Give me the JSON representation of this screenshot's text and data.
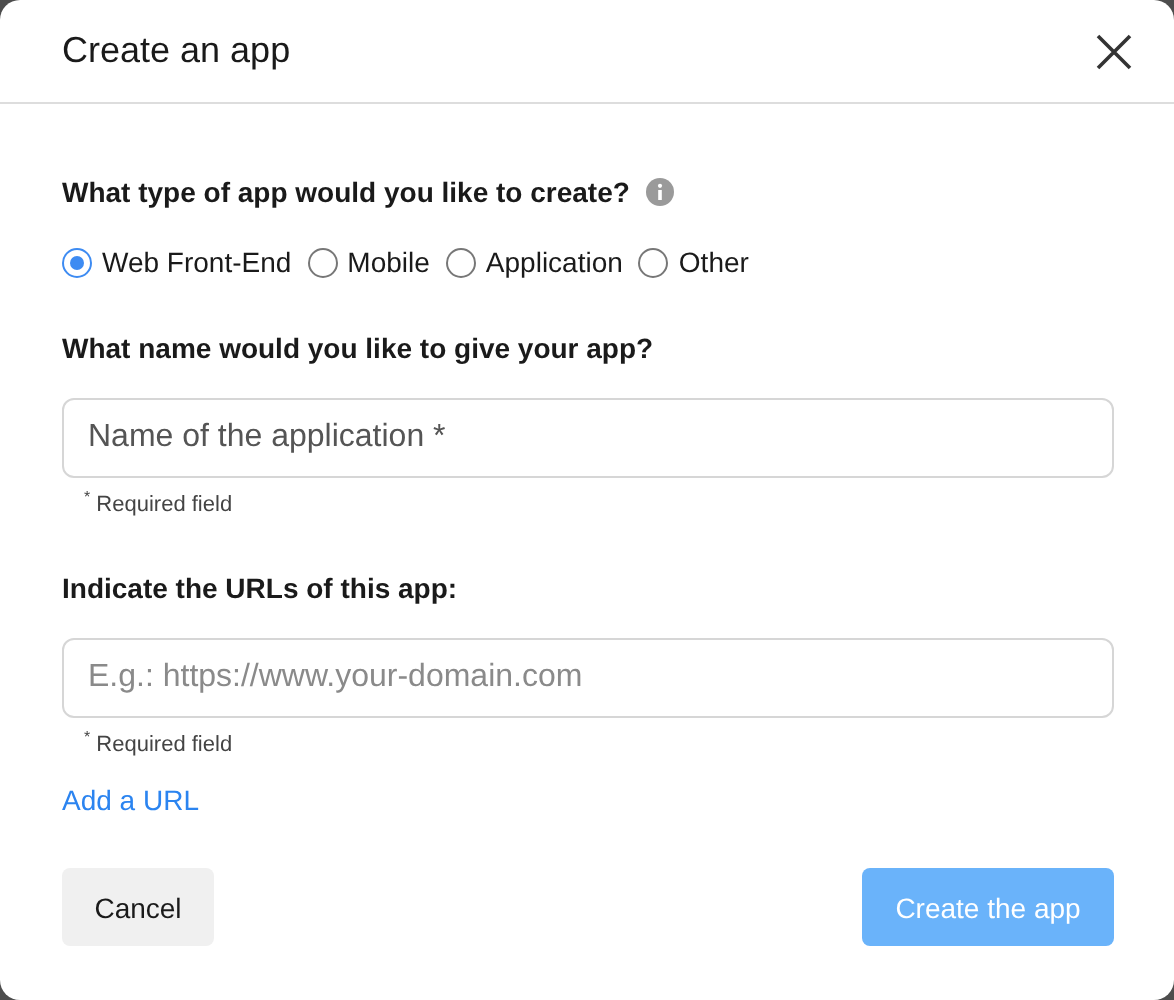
{
  "dialog": {
    "title": "Create an app"
  },
  "type_question": {
    "label": "What type of app would you like to create?"
  },
  "app_types": [
    {
      "label": "Web Front-End",
      "selected": true
    },
    {
      "label": "Mobile",
      "selected": false
    },
    {
      "label": "Application",
      "selected": false
    },
    {
      "label": "Other",
      "selected": false
    }
  ],
  "name_field": {
    "label": "What name would you like to give your app?",
    "placeholder": "Name of the application *",
    "hint": "$^{*}$ Required field"
  },
  "url_field": {
    "label": "Indicate the URLs of this app:",
    "placeholder": "E.g.: https://www.your-domain.com",
    "hint": "$^{*}$ Required field"
  },
  "add_url_link": "Add a URL",
  "buttons": [
    {
      "label": "Cancel",
      "kind": "secondary",
      "disabled": false
    },
    {
      "label": "Create the app",
      "kind": "primary",
      "disabled": true
    }
  ]
}
